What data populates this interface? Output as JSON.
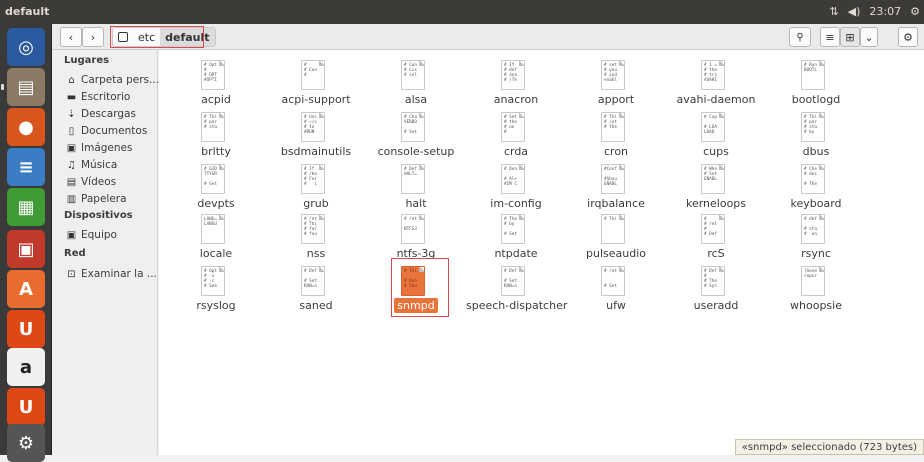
{
  "window": {
    "title": "default"
  },
  "panel": {
    "network": "⇅",
    "volume": "◀)",
    "time": "23:07",
    "gear": "⚙"
  },
  "launcher": [
    {
      "name": "dash-icon",
      "glyph": "◎",
      "bg": "#2c5aa0"
    },
    {
      "name": "files-icon",
      "glyph": "▤",
      "bg": "#8a7a66"
    },
    {
      "name": "firefox-icon",
      "glyph": "●",
      "bg": "#d8561d"
    },
    {
      "name": "writer-icon",
      "glyph": "≡",
      "bg": "#3b7dc4"
    },
    {
      "name": "calc-icon",
      "glyph": "▦",
      "bg": "#3f9c35"
    },
    {
      "name": "impress-icon",
      "glyph": "▣",
      "bg": "#c0392b"
    },
    {
      "name": "software-center-icon",
      "glyph": "A",
      "bg": "#e96b2e"
    },
    {
      "name": "ubuntu-one-icon",
      "glyph": "U",
      "bg": "#dd4814"
    },
    {
      "name": "amazon-icon",
      "glyph": "a",
      "bg": "#f0f0f0"
    },
    {
      "name": "ubuntu-one-music-icon",
      "glyph": "U",
      "bg": "#dd4814"
    },
    {
      "name": "system-settings-icon",
      "glyph": "⚙",
      "bg": "#555"
    }
  ],
  "toolbar": {
    "back": "‹",
    "forward": "›",
    "path": [
      "etc",
      "default"
    ],
    "search": "🔍",
    "menu": "≡",
    "view": "⊞",
    "dropdown": "⌄",
    "settings": "⚙"
  },
  "sidebar": {
    "lugares": "Lugares",
    "places": [
      {
        "icon": "⌂",
        "label": "Carpeta pers..."
      },
      {
        "icon": "▬",
        "label": "Escritorio"
      },
      {
        "icon": "⇣",
        "label": "Descargas"
      },
      {
        "icon": "▯",
        "label": "Documentos"
      },
      {
        "icon": "▣",
        "label": "Imágenes"
      },
      {
        "icon": "♫",
        "label": "Música"
      },
      {
        "icon": "▤",
        "label": "Vídeos"
      },
      {
        "icon": "▥",
        "label": "Papelera"
      }
    ],
    "dispositivos": "Dispositivos",
    "devices": [
      {
        "icon": "▣",
        "label": "Equipo"
      }
    ],
    "red": "Red",
    "network": [
      {
        "icon": "⊡",
        "label": "Examinar la ..."
      }
    ]
  },
  "files": [
    {
      "name": "acpid",
      "preview": "# Opt\n#\n# OPT\n#OPTI"
    },
    {
      "name": "acpi-support",
      "preview": "#\n# Con\n#"
    },
    {
      "name": "alsa",
      "preview": "# Con\n# Lis\n# snl"
    },
    {
      "name": "anacron",
      "preview": "# If\n# def\n# ana\n# (Th"
    },
    {
      "name": "apport",
      "preview": "# set\n# you\n# sud\nenabl"
    },
    {
      "name": "avahi-daemon",
      "preview": "# 1 =\n# the\n# trs\nAVAHI"
    },
    {
      "name": "bootlogd",
      "preview": "# Run\nBOOTL"
    },
    {
      "name": "brltty",
      "preview": "# Thi\n# per\n# sta"
    },
    {
      "name": "bsdmainutils",
      "preview": "# Unc\n# ~/c\n# to\n#RUN"
    },
    {
      "name": "console-setup",
      "preview": "# Cha\nVERBO\n\n# Set"
    },
    {
      "name": "crda",
      "preview": "# Set\n# the\n# on\n#"
    },
    {
      "name": "cron",
      "preview": "# Thi\n# /et\n# the"
    },
    {
      "name": "cups",
      "preview": "# Cup\n\n# LOA\nLOAD"
    },
    {
      "name": "dbus",
      "preview": "# Thi\n# per\n# sta\n# by"
    },
    {
      "name": "devpts",
      "preview": "# GID\nTTYGR\n\n# Set"
    },
    {
      "name": "grub",
      "preview": "# If\n# /bo\n# For\n#   i"
    },
    {
      "name": "halt",
      "preview": "# Def\nHALT="
    },
    {
      "name": "im-config",
      "preview": "# Dea\n\n# Al+\n#IM C"
    },
    {
      "name": "irqbalance",
      "preview": "#Conf\n\n#Shou\nENABL"
    },
    {
      "name": "kerneloops",
      "preview": "# Whe\n# Set\nENABL"
    },
    {
      "name": "keyboard",
      "preview": "# Che\n# doc\n\n# The"
    },
    {
      "name": "locale",
      "preview": "LANG=\nLANGU"
    },
    {
      "name": "nss",
      "preview": "# /et\n# Thi\n# for\n# fou"
    },
    {
      "name": "ntfs-3g",
      "preview": "# /et\n\nNTFS3"
    },
    {
      "name": "ntpdate",
      "preview": "# The\n# by\n\n# Set"
    },
    {
      "name": "pulseaudio",
      "preview": "# Thi"
    },
    {
      "name": "rcS",
      "preview": "#\n# /et\n#\n# Def"
    },
    {
      "name": "rsync",
      "preview": "# def\n\n# sta\n#  on"
    },
    {
      "name": "rsyslog",
      "preview": "# Opt\n# -x\n# -c\n# See"
    },
    {
      "name": "saned",
      "preview": "# Def\n\n# Set\nRUN=n"
    },
    {
      "name": "snmpd",
      "preview": "# Thi\n\n# Don\n# You",
      "selected": true
    },
    {
      "name": "speech-dispatcher",
      "preview": "# Def\n\n# Set\nRUN=n"
    },
    {
      "name": "ufw",
      "preview": "# /et\n\n\n# Set"
    },
    {
      "name": "useradd",
      "preview": "# Def\n#\n# The\n# Sys"
    },
    {
      "name": "whoopsie",
      "preview": "[Gene\nrepor"
    }
  ],
  "status": "«snmpd» seleccionado  (723 bytes)"
}
